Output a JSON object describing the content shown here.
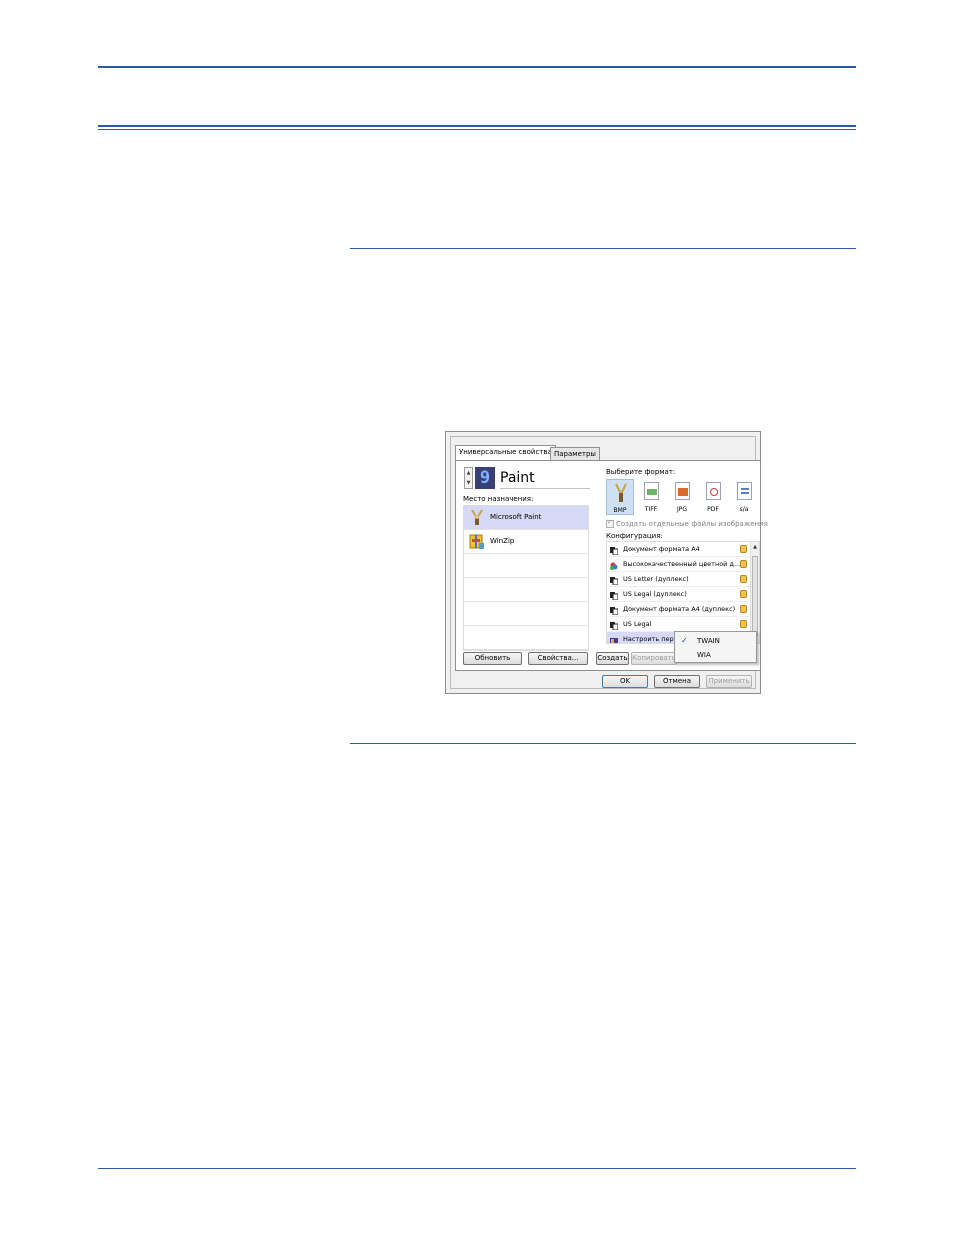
{
  "dialog": {
    "tabs": [
      {
        "label": "Универсальные свойства",
        "active": true
      },
      {
        "label": "Параметры",
        "active": false
      }
    ],
    "profile": {
      "number": "9",
      "name": "Paint"
    },
    "destination_label": "Место назначения:",
    "destinations": [
      {
        "label": "Microsoft Paint",
        "icon": "paint-icon",
        "selected": true
      },
      {
        "label": "WinZip",
        "icon": "winzip-icon",
        "selected": false
      }
    ],
    "format_label": "Выберите формат:",
    "formats": [
      {
        "label": "BMP",
        "selected": true
      },
      {
        "label": "TIFF",
        "selected": false
      },
      {
        "label": "JPG",
        "selected": false
      },
      {
        "label": "PDF",
        "selected": false
      },
      {
        "label": "s/a",
        "selected": false
      }
    ],
    "separate_files_label": "Создать отдельные файлы изображения",
    "config_label": "Конфигурация:",
    "configs": [
      {
        "label": "Документ формата A4",
        "icon": "bw-doc-icon"
      },
      {
        "label": "Высококачественный цветной д...",
        "icon": "color-doc-icon"
      },
      {
        "label": "US Letter (дуплекс)",
        "icon": "bw-doc-icon"
      },
      {
        "label": "US Legal (дуплекс)",
        "icon": "bw-doc-icon"
      },
      {
        "label": "Документ формата A4 (дуплекс)",
        "icon": "bw-doc-icon"
      },
      {
        "label": "US Legal",
        "icon": "bw-doc-icon"
      },
      {
        "label": "Настроить перед с",
        "icon": "scanner-config-icon",
        "selected": true
      }
    ],
    "context_menu": [
      {
        "label": "TWAIN",
        "checked": true
      },
      {
        "label": "WIA",
        "checked": false
      }
    ],
    "buttons": {
      "refresh": "Обновить",
      "properties": "Свойства...",
      "create": "Создать",
      "copy": "Копировать",
      "ok": "OK",
      "cancel": "Отмена",
      "apply": "Применить"
    }
  }
}
